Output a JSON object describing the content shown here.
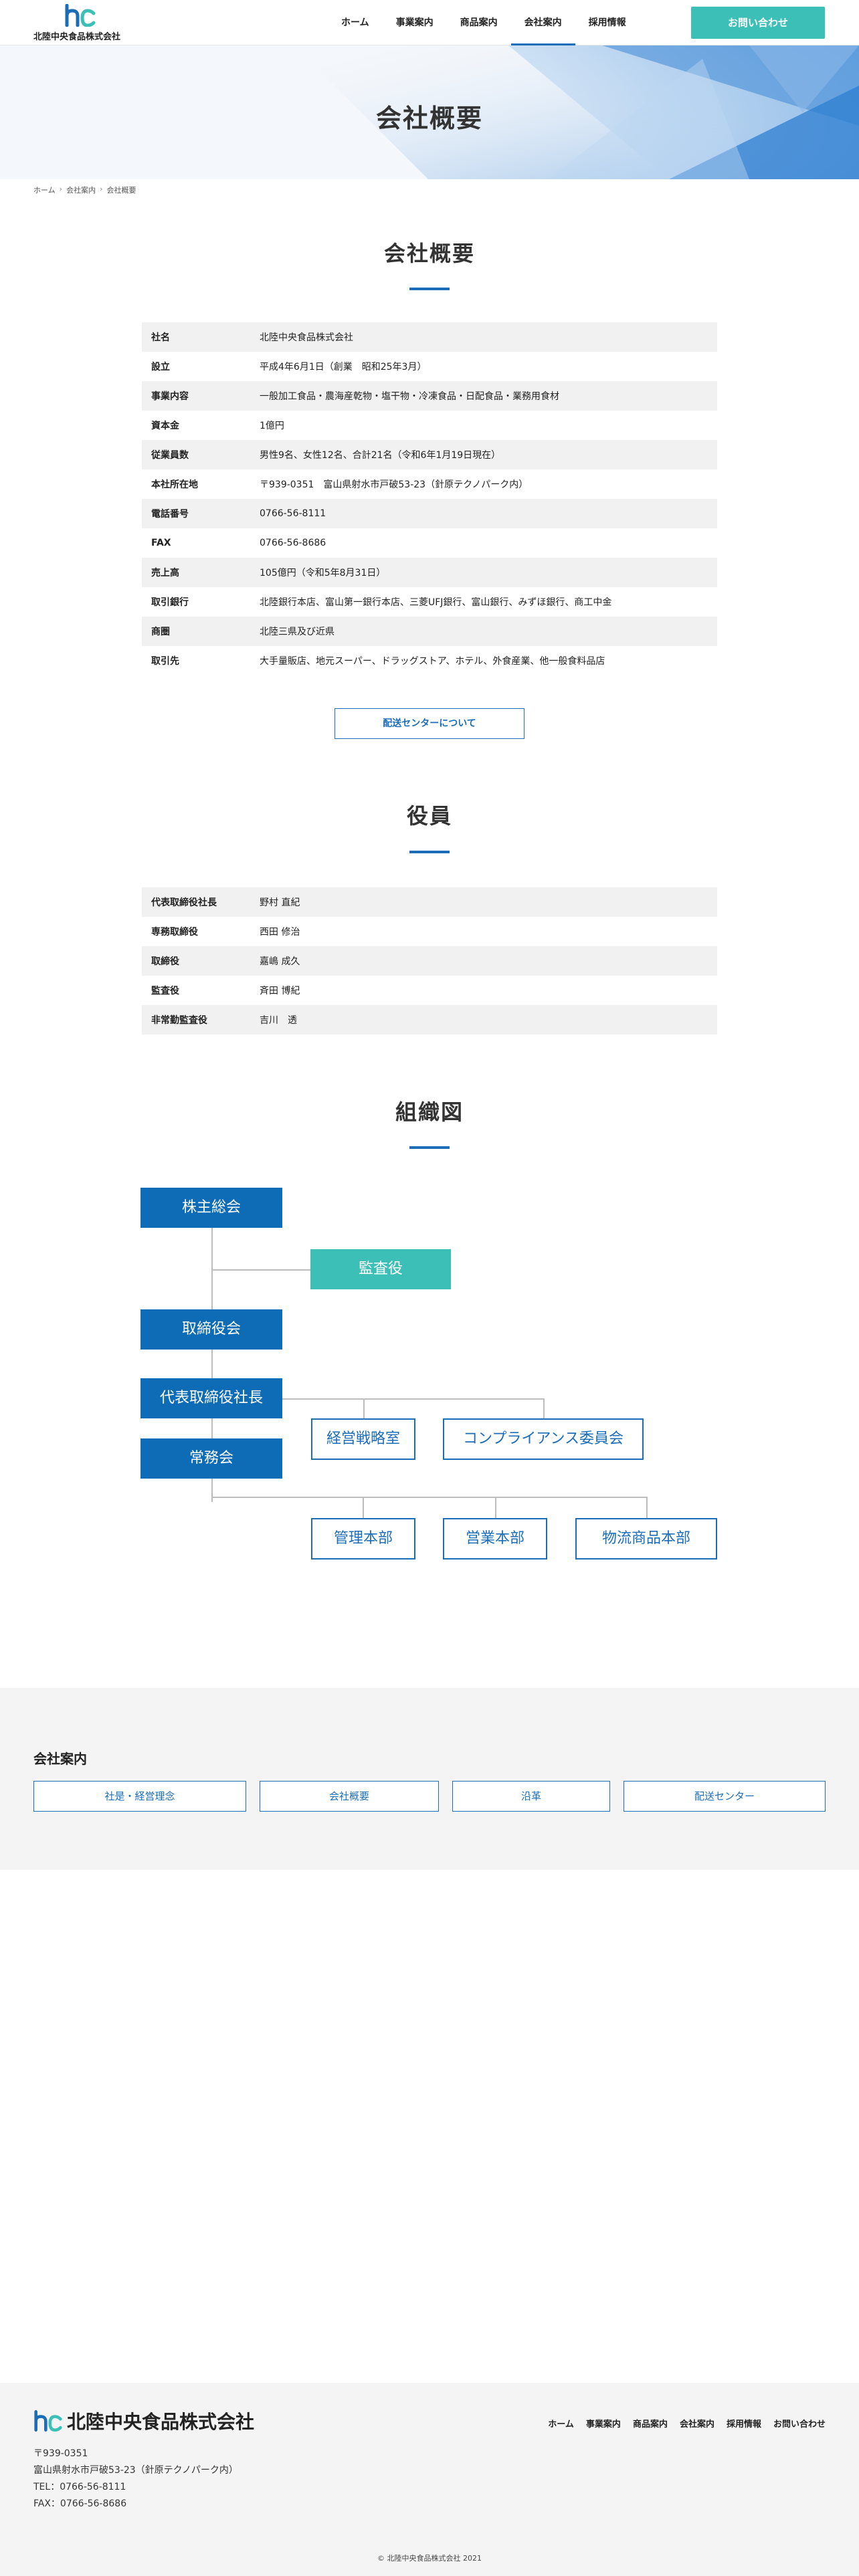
{
  "header": {
    "company_name": "北陸中央食品株式会社",
    "nav": [
      "ホーム",
      "事業案内",
      "商品案内",
      "会社案内",
      "採用情報"
    ],
    "contact_label": "お問い合わせ"
  },
  "hero": {
    "title": "会社概要"
  },
  "breadcrumb": [
    "ホーム",
    "会社案内",
    "会社概要"
  ],
  "overview": {
    "title": "会社概要",
    "rows": [
      {
        "label": "社名",
        "value": "北陸中央食品株式会社"
      },
      {
        "label": "設立",
        "value": "平成4年6月1日（創業　昭和25年3月）"
      },
      {
        "label": "事業内容",
        "value": "一般加工食品・農海産乾物・塩干物・冷凍食品・日配食品・業務用食材"
      },
      {
        "label": "資本金",
        "value": "1億円"
      },
      {
        "label": "従業員数",
        "value": "男性9名、女性12名、合計21名（令和6年1月19日現在）"
      },
      {
        "label": "本社所在地",
        "value": "〒939-0351　富山県射水市戸破53-23（針原テクノパーク内）"
      },
      {
        "label": "電話番号",
        "value": "0766-56-8111"
      },
      {
        "label": "FAX",
        "value": "0766-56-8686"
      },
      {
        "label": "売上高",
        "value": "105億円（令和5年8月31日）"
      },
      {
        "label": "取引銀行",
        "value": "北陸銀行本店、富山第一銀行本店、三菱UFJ銀行、富山銀行、みずほ銀行、商工中金"
      },
      {
        "label": "商圏",
        "value": "北陸三県及び近県"
      },
      {
        "label": "取引先",
        "value": "大手量販店、地元スーパー、ドラッグストア、ホテル、外食産業、他一般食料品店"
      }
    ],
    "delivery_label": "配送センターについて"
  },
  "officers": {
    "title": "役員",
    "rows": [
      {
        "label": "代表取締役社長",
        "value": "野村 直紀"
      },
      {
        "label": "専務取締役",
        "value": "西田 修治"
      },
      {
        "label": "取締役",
        "value": "嘉嶋 成久"
      },
      {
        "label": "監査役",
        "value": "斉田 博紀"
      },
      {
        "label": "非常勤監査役",
        "value": "吉川　透"
      }
    ]
  },
  "org": {
    "title": "組織図",
    "shareholders": "株主総会",
    "auditor": "監査役",
    "board": "取締役会",
    "president": "代表取締役社長",
    "executive": "常務会",
    "strategy": "経営戦略室",
    "compliance": "コンプライアンス委員会",
    "admin": "管理本部",
    "sales": "営業本部",
    "logistics": "物流商品本部"
  },
  "links": {
    "title": "会社案内",
    "items": [
      "社是・経営理念",
      "会社概要",
      "沿革",
      "配送センター"
    ]
  },
  "footer": {
    "company_name": "北陸中央食品株式会社",
    "nav": [
      "ホーム",
      "事業案内",
      "商品案内",
      "会社案内",
      "採用情報",
      "お問い合わせ"
    ],
    "address_lines": [
      "〒939-0351",
      "富山県射水市戸破53-23（針原テクノパーク内）",
      "TEL：0766-56-8111",
      "FAX：0766-56-8686"
    ],
    "copyright": "© 北陸中央食品株式会社 2021"
  },
  "colors": {
    "brand_blue": "#1c6db8",
    "teal": "#3bbfb7"
  }
}
